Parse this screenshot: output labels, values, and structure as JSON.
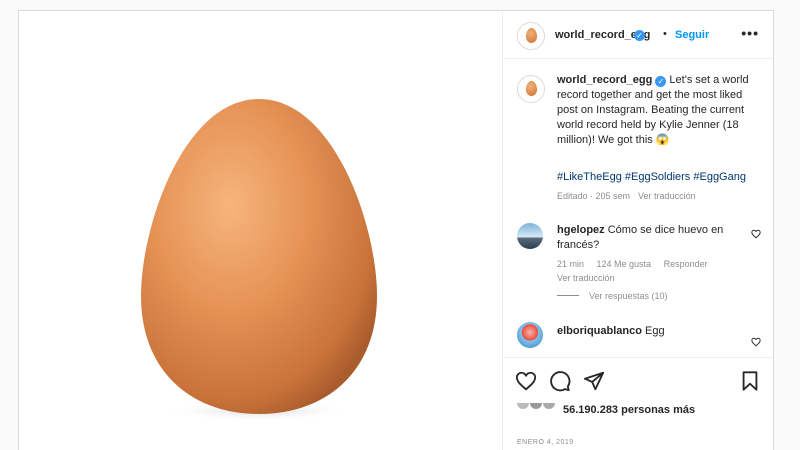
{
  "post": {
    "username": "world_record_egg",
    "dot": "•",
    "follow_label": "Seguir",
    "more_icon": "more-options-icon",
    "caption_text": "Let's set a world record together and get the most liked post on Instagram. Beating the current world record held by Kylie Jenner (18 million)! We got this 😱",
    "hashtags": "#LikeTheEgg #EggSoldiers #EggGang",
    "caption_edited": "Editado · 205 sem",
    "caption_translate": "Ver traducción"
  },
  "comments": [
    {
      "username": "hgelopez",
      "text": "Cómo se dice huevo en francés?",
      "time": "21 min",
      "likes": "124 Me gusta",
      "reply": "Responder",
      "translate": "Ver traducción"
    },
    {
      "username": "elboriquablanco",
      "text": "Egg"
    }
  ],
  "view_replies": "Ver respuestas (10)",
  "likes_text": "56.190.283 personas más",
  "date": "ENERO 4, 2019",
  "colors": {
    "accent": "#0095f6",
    "verified": "#3897f0",
    "text": "#262626",
    "muted": "#8e8e8e",
    "hashtag": "#00376b",
    "egg": "#e38d50"
  },
  "icons": [
    "verified-badge-icon",
    "heart-icon",
    "comment-icon",
    "share-icon",
    "bookmark-icon",
    "more-options-icon"
  ]
}
